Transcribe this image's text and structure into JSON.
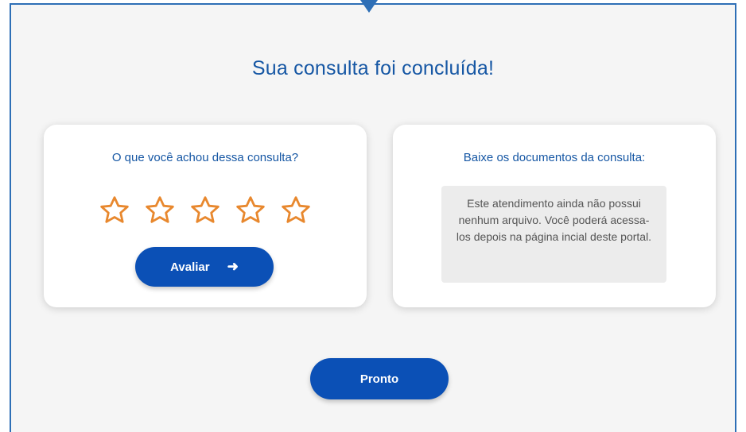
{
  "page": {
    "title": "Sua consulta foi concluída!"
  },
  "rating_card": {
    "heading": "O que você achou dessa consulta?",
    "star_count": 5,
    "stars_selected": 0,
    "button_label": "Avaliar",
    "button_icon": "arrow-right-icon"
  },
  "documents_card": {
    "heading": "Baixe os documentos da consulta:",
    "notice": "Este atendimento ainda não possui nenhum arquivo. Você poderá acessa-los depois na página incial deste portal."
  },
  "footer": {
    "done_label": "Pronto"
  },
  "colors": {
    "accent": "#0b50b6",
    "title_blue": "#1657a4",
    "star_orange": "#e8882e",
    "frame_border": "#2e6fb6",
    "background": "#f5f5f5"
  }
}
